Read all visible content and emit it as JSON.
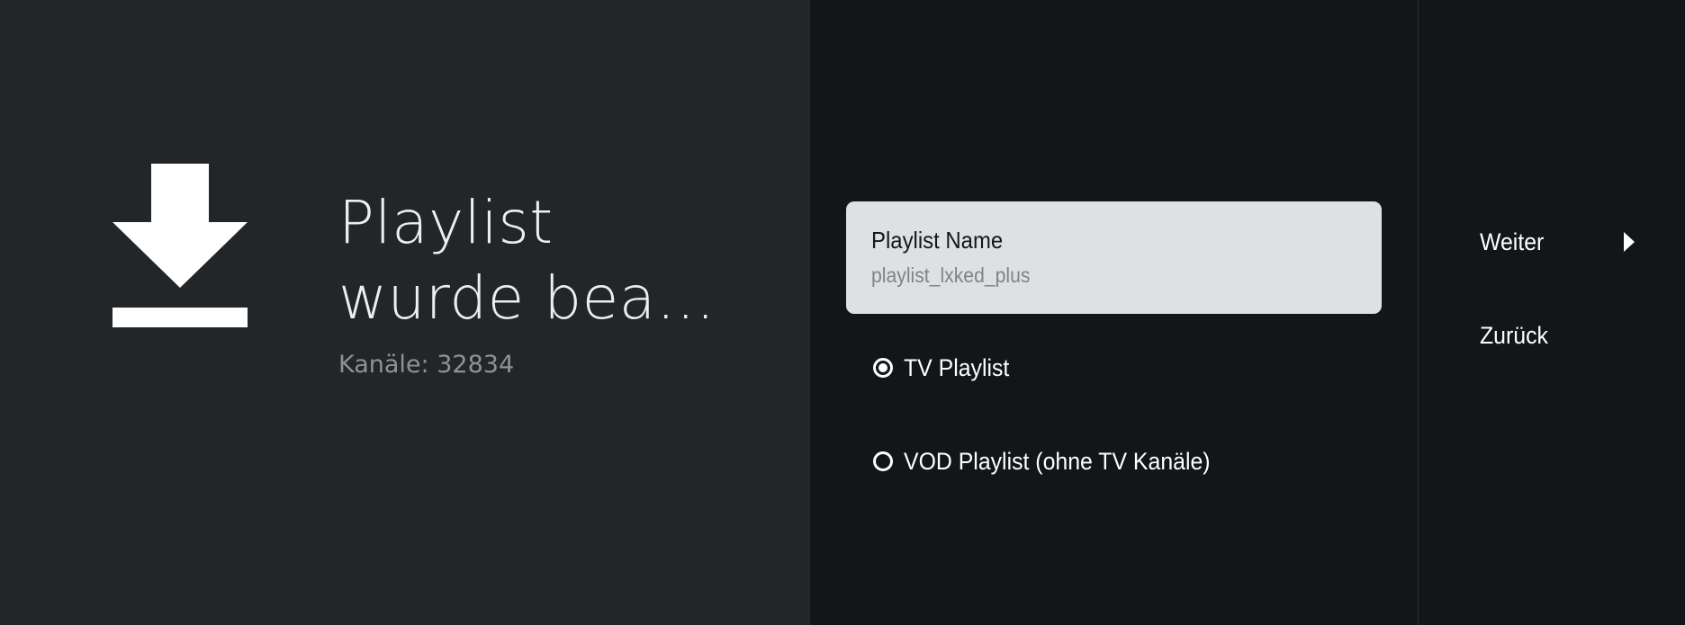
{
  "guidance": {
    "icon": "download-icon",
    "title_line1": "Playlist",
    "title_line2": "wurde bea…",
    "description": "Kanäle: 32834"
  },
  "actions": {
    "playlist_name": {
      "label": "Playlist Name",
      "value": "playlist_lxked_plus"
    },
    "options": [
      {
        "label": "TV Playlist",
        "checked": true
      },
      {
        "label": "VOD Playlist (ohne TV Kanäle)",
        "checked": false
      }
    ]
  },
  "buttons": {
    "next": {
      "label": "Weiter",
      "icon": "chevron-right-icon"
    },
    "back": {
      "label": "Zurück"
    }
  },
  "colors": {
    "guidance_bg": "#232629",
    "actions_bg": "#121619",
    "field_bg": "#dde1e3",
    "text_primary": "#ffffff",
    "text_secondary": "#8e9295"
  }
}
